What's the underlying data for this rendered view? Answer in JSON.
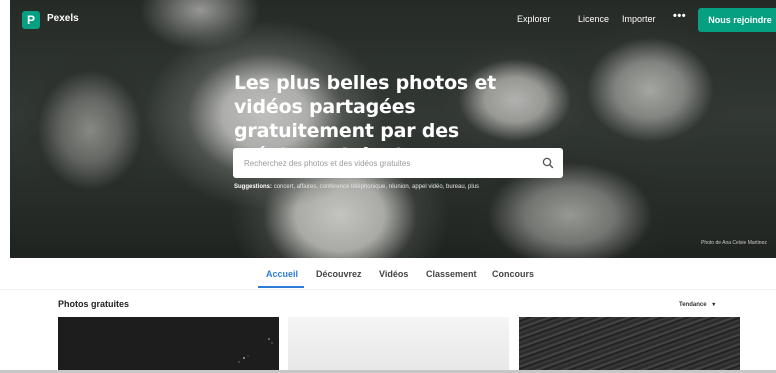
{
  "nav": {
    "brand": "Pexels",
    "logo_glyph": "P",
    "links": [
      "Explorer",
      "Licence",
      "Importer"
    ],
    "more": "•••",
    "join_label": "Nous rejoindre"
  },
  "hero": {
    "headline": "Les plus belles photos et vidéos partagées gratuitement par des créateurs talentueux.",
    "search_placeholder": "Recherchez des photos et des vidéos gratuites",
    "suggestions_label": "Suggestions:",
    "suggestions_text": "concert, affaires, conférence téléphonique, réunion, appel vidéo, bureau, plus",
    "credit": "Photo de Ana Celsie Martinez"
  },
  "tabs": [
    "Accueil",
    "Découvrez",
    "Vidéos",
    "Classement",
    "Concours"
  ],
  "active_tab": "Accueil",
  "section": {
    "title": "Photos gratuites",
    "sort_label": "Tendance",
    "sort_caret": "▾"
  },
  "colors": {
    "accent": "#05a081",
    "tab_active": "#2d7cd6"
  }
}
